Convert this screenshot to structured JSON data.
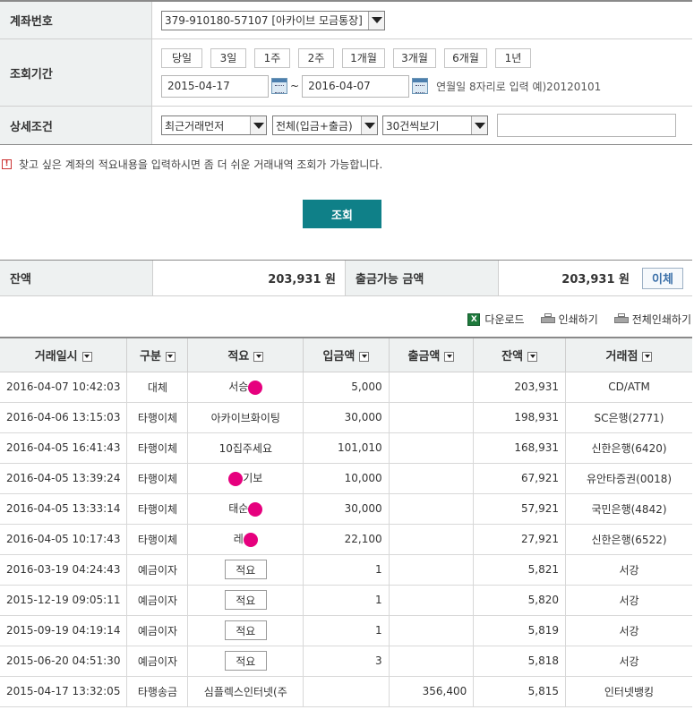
{
  "form": {
    "account_label": "계좌번호",
    "account_value": "379-910180-57107 [아카이브 모금통장]",
    "period_label": "조회기간",
    "period_buttons": [
      "당일",
      "3일",
      "1주",
      "2주",
      "1개월",
      "3개월",
      "6개월",
      "1년"
    ],
    "date_from": "2015-04-17",
    "date_tilde": "~",
    "date_to": "2016-04-07",
    "date_hint": "연월일 8자리로 입력 예)20120101",
    "detail_label": "상세조건",
    "order_select": "최근거래먼저",
    "type_select": "전체(입금+출금)",
    "count_select": "30건씩보기",
    "memo_search_value": ""
  },
  "notice": {
    "icon": "exclamation-icon",
    "text": "찾고 싶은 계좌의 적요내용을 입력하시면 좀 더 쉬운 거래내역 조회가 가능합니다."
  },
  "search_button": "조회",
  "balance": {
    "label": "잔액",
    "value": "203,931 원",
    "available_label": "출금가능 금액",
    "available_value": "203,931 원",
    "transfer_button": "이체"
  },
  "tools": {
    "download": "다운로드",
    "print": "인쇄하기",
    "print_all": "전체인쇄하기"
  },
  "table": {
    "headers": [
      "거래일시",
      "구분",
      "적요",
      "입금액",
      "출금액",
      "잔액",
      "거래점"
    ],
    "memo_button": "적요",
    "redact_color": "#e6007e",
    "rows": [
      {
        "datetime": "2016-04-07 10:42:03",
        "type": "대체",
        "memo_pre": "서승",
        "memo_post": "",
        "redacted": true,
        "deposit": "5,000",
        "withdraw": "",
        "balance": "203,931",
        "branch": "CD/ATM"
      },
      {
        "datetime": "2016-04-06 13:15:03",
        "type": "타행이체",
        "memo_pre": "아카이브화이팅",
        "memo_post": "",
        "redacted": false,
        "deposit": "30,000",
        "withdraw": "",
        "balance": "198,931",
        "branch": "SC은행(2771)"
      },
      {
        "datetime": "2016-04-05 16:41:43",
        "type": "타행이체",
        "memo_pre": "10집주세요",
        "memo_post": "",
        "redacted": false,
        "deposit": "101,010",
        "withdraw": "",
        "balance": "168,931",
        "branch": "신한은행(6420)"
      },
      {
        "datetime": "2016-04-05 13:39:24",
        "type": "타행이체",
        "memo_pre": "",
        "memo_post": "기보",
        "redacted": true,
        "deposit": "10,000",
        "withdraw": "",
        "balance": "67,921",
        "branch": "유안타증권(0018)"
      },
      {
        "datetime": "2016-04-05 13:33:14",
        "type": "타행이체",
        "memo_pre": "태순",
        "memo_post": "",
        "redacted": true,
        "deposit": "30,000",
        "withdraw": "",
        "balance": "57,921",
        "branch": "국민은행(4842)"
      },
      {
        "datetime": "2016-04-05 10:17:43",
        "type": "타행이체",
        "memo_pre": "레",
        "memo_post": "",
        "redacted": true,
        "deposit": "22,100",
        "withdraw": "",
        "balance": "27,921",
        "branch": "신한은행(6522)"
      },
      {
        "datetime": "2016-03-19 04:24:43",
        "type": "예금이자",
        "memo_btn": true,
        "deposit": "1",
        "withdraw": "",
        "balance": "5,821",
        "branch": "서강"
      },
      {
        "datetime": "2015-12-19 09:05:11",
        "type": "예금이자",
        "memo_btn": true,
        "deposit": "1",
        "withdraw": "",
        "balance": "5,820",
        "branch": "서강"
      },
      {
        "datetime": "2015-09-19 04:19:14",
        "type": "예금이자",
        "memo_btn": true,
        "deposit": "1",
        "withdraw": "",
        "balance": "5,819",
        "branch": "서강"
      },
      {
        "datetime": "2015-06-20 04:51:30",
        "type": "예금이자",
        "memo_btn": true,
        "deposit": "3",
        "withdraw": "",
        "balance": "5,818",
        "branch": "서강"
      },
      {
        "datetime": "2015-04-17 13:32:05",
        "type": "타행송금",
        "memo_pre": "심플렉스인터넷(주",
        "memo_post": "",
        "redacted": false,
        "deposit": "",
        "withdraw": "356,400",
        "balance": "5,815",
        "branch": "인터넷뱅킹"
      }
    ]
  }
}
